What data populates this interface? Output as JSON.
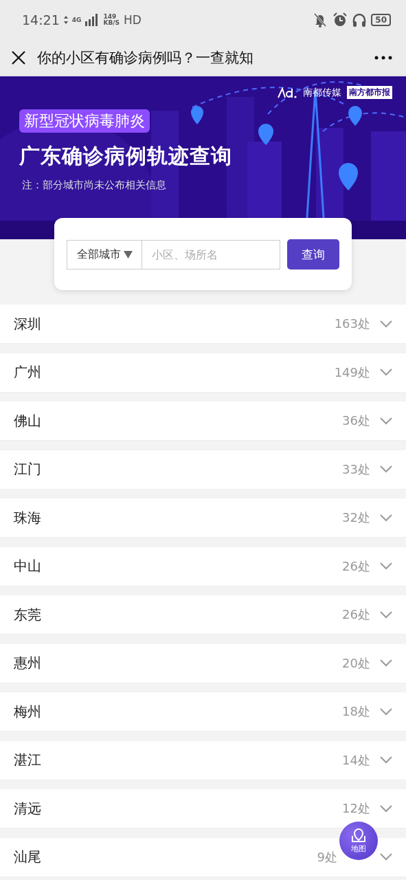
{
  "status_bar": {
    "time": "14:21",
    "network": "4G",
    "speed": "149",
    "speed_unit": "KB/S",
    "hd": "HD",
    "battery": "50"
  },
  "nav": {
    "title": "你的小区有确诊病例吗？一查就知"
  },
  "banner": {
    "tag": "新型冠状病毒肺炎",
    "title": "广东确诊病例轨迹查询",
    "note": "注：部分城市尚未公布相关信息",
    "logos": [
      "南都传媒",
      "南方都市报"
    ]
  },
  "search": {
    "city_select": "全部城市",
    "placeholder": "小区、场所名",
    "button": "查询"
  },
  "cities": [
    {
      "name": "深圳",
      "count": "163处",
      "expanded": false
    },
    {
      "name": "广州",
      "count": "149处",
      "expanded": false
    },
    {
      "name": "佛山",
      "count": "36处",
      "expanded": false
    },
    {
      "name": "江门",
      "count": "33处",
      "expanded": false
    },
    {
      "name": "珠海",
      "count": "32处",
      "expanded": false
    },
    {
      "name": "中山",
      "count": "26处",
      "expanded": false
    },
    {
      "name": "东莞",
      "count": "26处",
      "expanded": false
    },
    {
      "name": "惠州",
      "count": "20处",
      "expanded": false
    },
    {
      "name": "梅州",
      "count": "18处",
      "expanded": false
    },
    {
      "name": "湛江",
      "count": "14处",
      "expanded": false
    },
    {
      "name": "清远",
      "count": "12处",
      "expanded": false
    },
    {
      "name": "汕尾",
      "count": "9处",
      "expanded": false
    }
  ],
  "map_button": {
    "label": "地图"
  }
}
